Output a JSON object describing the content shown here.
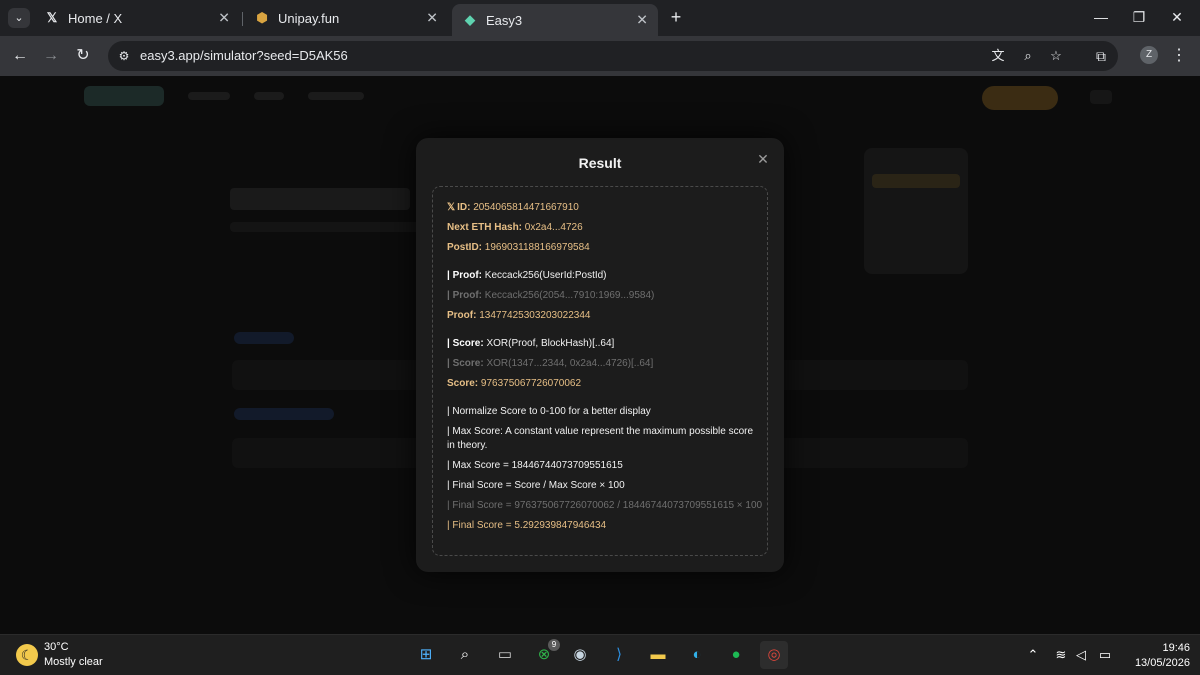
{
  "browser": {
    "tabs": [
      {
        "title": "Home / X",
        "icon": "x-logo-icon"
      },
      {
        "title": "Unipay.fun",
        "icon": "unipay-icon"
      },
      {
        "title": "Easy3",
        "icon": "easy3-icon",
        "active": true
      }
    ],
    "url": "easy3.app/simulator?seed=D5AK56",
    "profile_initial": "Z"
  },
  "modal": {
    "title": "Result",
    "lines": [
      {
        "key": "ID:",
        "value": "2054065814471667910",
        "style": "gold",
        "xlogo": true
      },
      {
        "key": "Next ETH Hash:",
        "value": "0x2a4...4726",
        "style": "gold"
      },
      {
        "key": "PostID:",
        "value": "1969031188166979584",
        "style": "gold"
      },
      {
        "key": "| Proof:",
        "value": "Keccack256(UserId:PostId)",
        "style": "white",
        "gap": true
      },
      {
        "key": "| Proof:",
        "value": "Keccack256(2054...7910:1969...9584)",
        "style": "gray"
      },
      {
        "key": "Proof:",
        "value": "13477425303203022344",
        "style": "gold"
      },
      {
        "key": "| Score:",
        "value": "XOR(Proof, BlockHash)[..64]",
        "style": "white",
        "gap": true
      },
      {
        "key": "| Score:",
        "value": "XOR(1347...2344, 0x2a4...4726)[..64]",
        "style": "gray"
      },
      {
        "key": "Score:",
        "value": "976375067726070062",
        "style": "gold"
      },
      {
        "key": "",
        "value": "| Normalize Score to 0-100 for a better display",
        "style": "white",
        "gap": true
      },
      {
        "key": "",
        "value": "| Max Score: A constant value represent the maximum possible score in theory.",
        "style": "white",
        "wrap": true
      },
      {
        "key": "",
        "value": "| Max Score = 18446744073709551615",
        "style": "white"
      },
      {
        "key": "",
        "value": "| Final Score = Score / Max Score × 100",
        "style": "white"
      },
      {
        "key": "",
        "value": "| Final Score =  976375067726070062 / 18446744073709551615 × 100",
        "style": "gray"
      },
      {
        "key": "",
        "value": "| Final Score = 5.292939847946434",
        "style": "gold"
      }
    ]
  },
  "taskbar": {
    "weather_temp": "30°C",
    "weather_desc": "Mostly clear",
    "xbox_badge": "9",
    "time": "19:46",
    "date": "13/05/2026"
  },
  "colors": {
    "accent_gold": "#e7bf86",
    "modal_bg": "#1c1c1c",
    "chrome_dark": "#202124"
  }
}
